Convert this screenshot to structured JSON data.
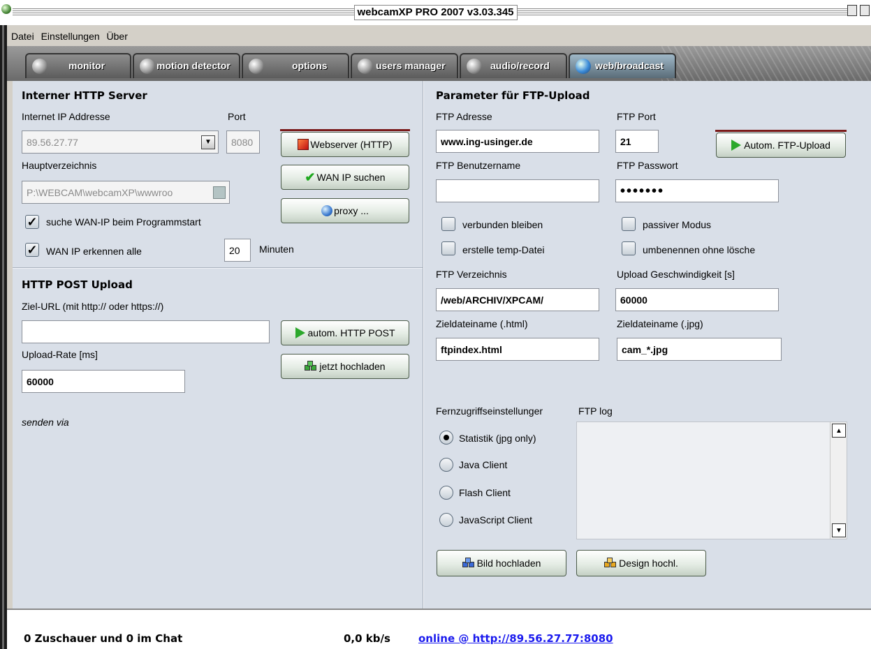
{
  "window": {
    "title": "webcamXP PRO 2007 v3.03.345"
  },
  "menu": {
    "items": [
      "Datei",
      "Einstellungen",
      "Über"
    ]
  },
  "tabs": [
    {
      "label": "monitor",
      "icon": "webcam-icon"
    },
    {
      "label": "motion detector",
      "icon": "motion-icon"
    },
    {
      "label": "options",
      "icon": "options-icon"
    },
    {
      "label": "users manager",
      "icon": "users-icon"
    },
    {
      "label": "audio/record",
      "icon": "audio-icon"
    },
    {
      "label": "web/broadcast",
      "icon": "globe-icon",
      "active": true
    }
  ],
  "http_server": {
    "heading": "Interner HTTP Server",
    "ip_label": "Internet IP Addresse",
    "ip_value": "89.56.27.77",
    "port_label": "Port",
    "port_value": "8080",
    "webserver_button": "Webserver (HTTP)",
    "root_label": "Hauptverzeichnis",
    "root_value": "P:\\WEBCAM\\webcamXP\\wwwroo",
    "wan_search_button": "WAN IP suchen",
    "proxy_button": "proxy ...",
    "search_on_start_label": "suche WAN-IP beim Programmstart",
    "detect_every_label": "WAN IP erkennen alle",
    "detect_every_value": "20",
    "minutes_label": "Minuten"
  },
  "http_post": {
    "heading": "HTTP POST Upload",
    "url_label": "Ziel-URL (mit http:// oder https://)",
    "url_value": "",
    "auto_post_button": "autom. HTTP POST",
    "upload_now_button": "jetzt hochladen",
    "rate_label": "Upload-Rate [ms]",
    "rate_value": "60000",
    "send_via_label": "senden via"
  },
  "ftp": {
    "heading": "Parameter für FTP-Upload",
    "address_label": "FTP Adresse",
    "address_value": "www.ing-usinger.de",
    "port_label": "FTP Port",
    "port_value": "21",
    "auto_upload_button": "Autom. FTP-Upload",
    "user_label": "FTP Benutzername",
    "user_value": "",
    "password_label": "FTP Passwort",
    "password_value": "•••••••",
    "stay_connected_label": "verbunden bleiben",
    "passive_mode_label": "passiver Modus",
    "temp_file_label": "erstelle temp-Datei",
    "rename_label": "umbenennen ohne lösche",
    "directory_label": "FTP Verzeichnis",
    "directory_value": "/web/ARCHIV/XPCAM/",
    "speed_label": "Upload Geschwindigkeit [s]",
    "speed_value": "60000",
    "html_target_label": "Zieldateiname (.html)",
    "html_target_value": "ftpindex.html",
    "jpg_target_label": "Zieldateiname (.jpg)",
    "jpg_target_value": "cam_*.jpg",
    "remote_label": "Fernzugriffseinstellunger",
    "log_label": "FTP log",
    "remote_options": [
      "Statistik (jpg only)",
      "Java Client",
      "Flash Client",
      "JavaScript Client"
    ],
    "upload_image_button": "Bild hochladen",
    "upload_design_button": "Design hochl."
  },
  "status": {
    "viewers": "0 Zuschauer und 0 im Chat",
    "rate": "0,0 kb/s",
    "online": "online @ http://89.56.27.77:8080"
  }
}
